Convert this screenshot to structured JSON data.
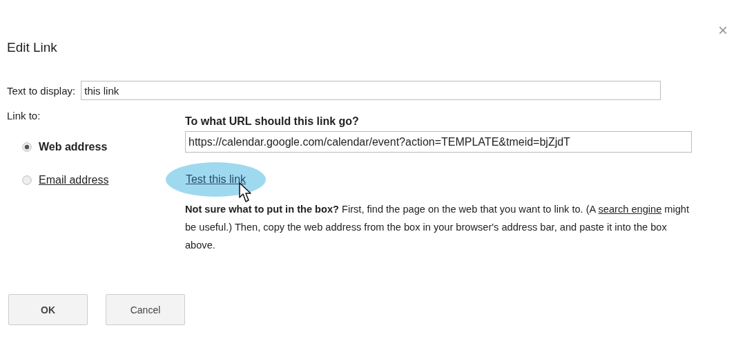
{
  "dialog": {
    "title": "Edit Link",
    "close": "×"
  },
  "text_to_display": {
    "label": "Text to display:",
    "value": "this link"
  },
  "link_to": {
    "label": "Link to:",
    "options": [
      {
        "label": "Web address",
        "selected": true
      },
      {
        "label": "Email address",
        "selected": false
      }
    ]
  },
  "url": {
    "heading": "To what URL should this link go?",
    "value": "https://calendar.google.com/calendar/event?action=TEMPLATE&tmeid=bjZjdT",
    "test_link": "Test this link"
  },
  "help": {
    "lead": "Not sure what to put in the box?",
    "before_link": " First, find the page on the web that you want to link to. (A ",
    "link": "search engine",
    "after_link": " might be useful.) Then, copy the web address from the box in your browser's address bar, and paste it into the box above."
  },
  "buttons": [
    "OK",
    "Cancel"
  ]
}
